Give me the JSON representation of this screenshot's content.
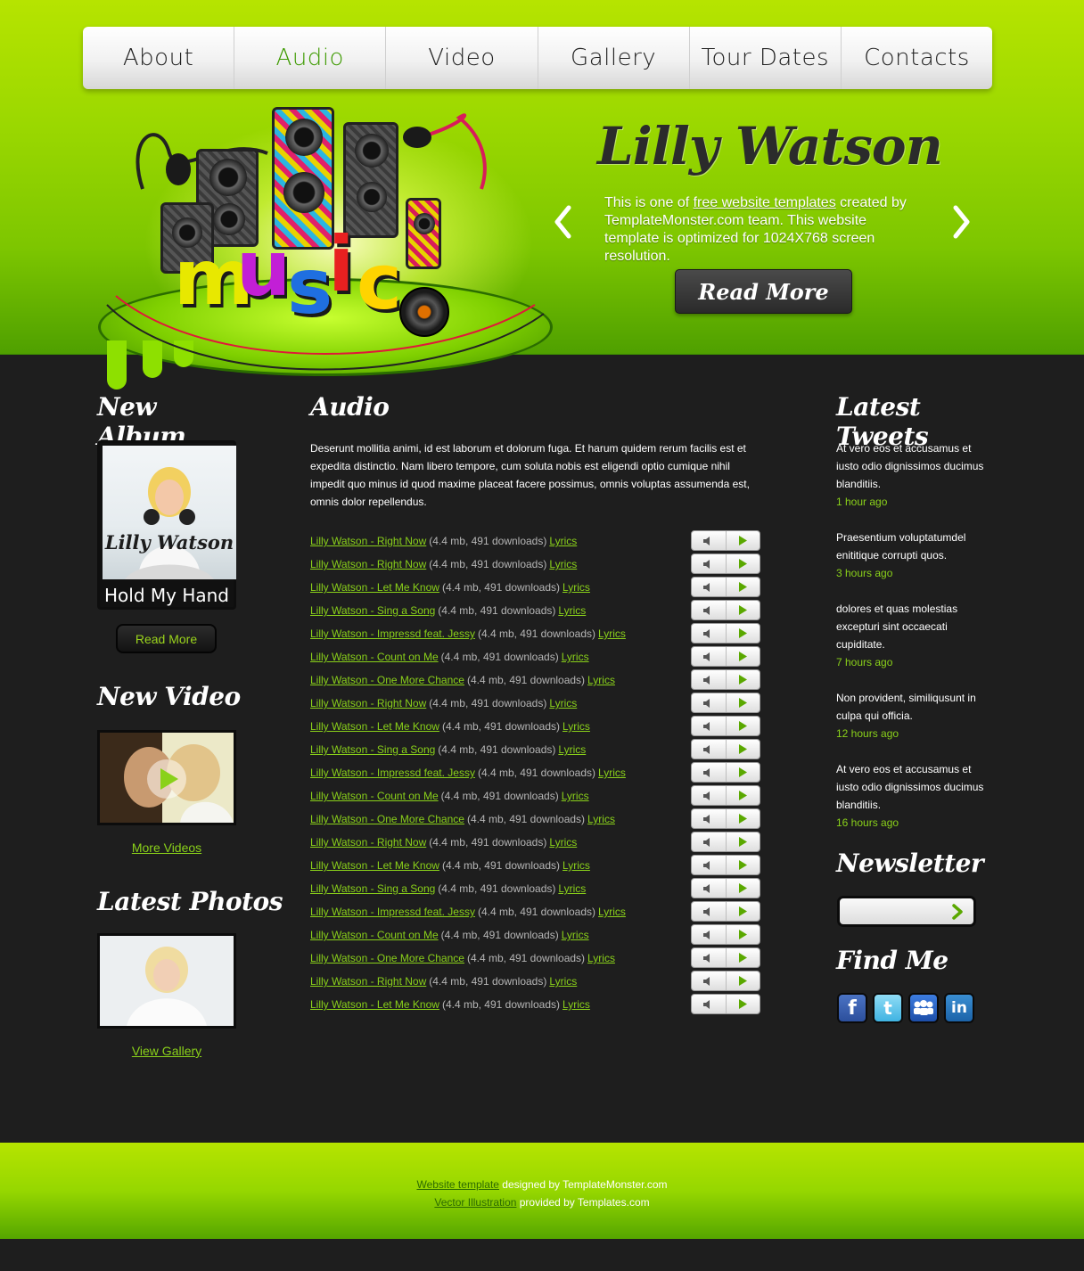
{
  "nav": {
    "items": [
      "About",
      "Audio",
      "Video",
      "Gallery",
      "Tour Dates",
      "Contacts"
    ],
    "active": "Audio"
  },
  "hero": {
    "art_word": "music",
    "artist": "Lilly Watson",
    "text_before": "This is one of ",
    "text_link": "free website templates",
    "text_after": " created by TemplateMonster.com team. This website template is optimized for 1024X768 screen resolution.",
    "read_more": "Read More",
    "prev_icon": "chevron-left-icon",
    "next_icon": "chevron-right-icon"
  },
  "left": {
    "album_title": "New Album",
    "album_cover_text": "Lilly Watson",
    "album_name": "Hold My Hand",
    "album_button": "Read More",
    "video_title": "New Video",
    "video_link": "More Videos",
    "photos_title": "Latest Photos",
    "photos_link": "View Gallery"
  },
  "audio": {
    "title": "Audio",
    "description": "Deserunt mollitia animi, id est laborum et dolorum fuga. Et harum quidem rerum facilis est et expedita distinctio. Nam libero tempore, cum soluta nobis est eligendi optio cumique nihil impedit quo minus id quod maxime placeat facere possimus, omnis voluptas assumenda est, omnis dolor repellendus.",
    "meta": "(4.4 mb, 491 downloads)",
    "lyrics_label": "Lyrics",
    "tracks": [
      "Lilly Watson - Right Now",
      "Lilly Watson - Right Now",
      "Lilly Watson - Let Me Know",
      "Lilly Watson - Sing a Song",
      "Lilly Watson - Impressd feat. Jessy",
      "Lilly Watson - Count on Me",
      "Lilly Watson - One More Chance",
      "Lilly Watson - Right Now",
      "Lilly Watson - Let Me Know",
      "Lilly Watson - Sing a Song",
      "Lilly Watson - Impressd feat. Jessy",
      "Lilly Watson - Count on Me",
      "Lilly Watson - One More Chance",
      "Lilly Watson - Right Now",
      "Lilly Watson - Let Me Know",
      "Lilly Watson - Sing a Song",
      "Lilly Watson - Impressd feat. Jessy",
      "Lilly Watson - Count on Me",
      "Lilly Watson - One More Chance",
      "Lilly Watson - Right Now",
      "Lilly Watson - Let Me Know"
    ]
  },
  "right": {
    "tweets_title": "Latest Tweets",
    "tweets": [
      {
        "text": "At vero eos et accusamus et iusto odio dignissimos ducimus blanditiis.",
        "time": "1 hour ago"
      },
      {
        "text": "Praesentium voluptatumdel enititique corrupti quos.",
        "time": "3 hours ago"
      },
      {
        "text": "dolores et quas molestias excepturi sint occaecati cupiditate.",
        "time": "7 hours ago"
      },
      {
        "text": "Non provident, similiqusunt in culpa qui officia.",
        "time": "12 hours ago"
      },
      {
        "text": "At vero eos et accusamus et iusto odio dignissimos ducimus blanditiis.",
        "time": "16 hours ago"
      }
    ],
    "newsletter_title": "Newsletter",
    "newsletter_placeholder": "",
    "findme_title": "Find Me",
    "social": [
      "facebook-icon",
      "twitter-icon",
      "myspace-icon",
      "linkedin-icon"
    ]
  },
  "footer": {
    "line1_link": "Website template",
    "line1_text": " designed by TemplateMonster.com",
    "line2_link": "Vector Illustration",
    "line2_text": " provided by Templates.com"
  },
  "colors": {
    "accent_green": "#8ad11a",
    "header_green": "#9bd800",
    "dark_bg": "#1e1e1e",
    "active_nav": "#3d9a00"
  }
}
